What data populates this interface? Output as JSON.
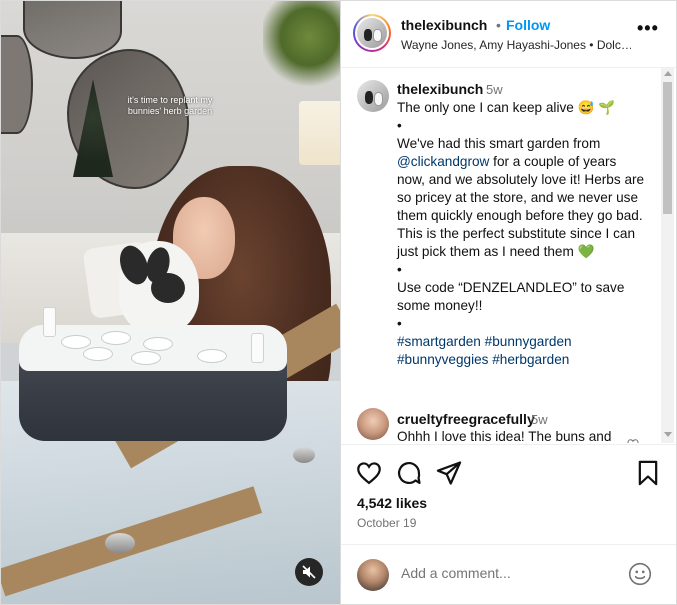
{
  "media": {
    "overlay_text": "it's time to replant my bunnies' herb garden",
    "mute_icon": "speaker-muted-icon"
  },
  "header": {
    "username": "thelexibunch",
    "separator": "•",
    "follow_label": "Follow",
    "subtitle": "Wayne Jones, Amy Hayashi-Jones • Dolc…",
    "more_icon": "more-options-icon",
    "more_label": "•••"
  },
  "caption": {
    "username": "thelexibunch",
    "time": "5w",
    "line1": "The only one I can keep alive 😅 🌱",
    "bullet1": "•",
    "para1_prefix": "We've had this smart garden from ",
    "mention": "@clickandgrow",
    "para1_suffix": " for a couple of years now, and we absolutely love it! Herbs are so pricey at the store, and we never use them quickly enough before they go bad. This is the perfect substitute since I can just pick them as I need them 💚",
    "bullet2": "•",
    "para2": "Use code “DENZELANDLEO” to save some money!!",
    "bullet3": "•",
    "hashtags1": "#smartgarden #bunnygarden",
    "hashtags2": "#bunnyveggies #herbgarden"
  },
  "comment2": {
    "username": "crueltyfreegracefully",
    "time": "5w",
    "text": "Ohhh I love this idea! The buns and"
  },
  "actions": {
    "like_icon": "heart-icon",
    "comment_icon": "comment-icon",
    "share_icon": "share-icon",
    "save_icon": "bookmark-icon",
    "likes": "4,542 likes",
    "date": "October 19"
  },
  "add_comment": {
    "placeholder": "Add a comment...",
    "emoji_icon": "emoji-icon"
  },
  "colors": {
    "follow_blue": "#0095f6",
    "link_blue": "#00376b",
    "muted_gray": "#737373"
  }
}
